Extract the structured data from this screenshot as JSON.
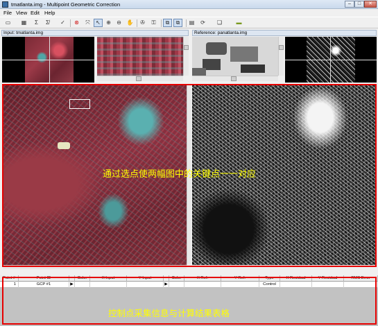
{
  "window": {
    "title": "tmatlanta.img - Multipoint Geometric Correction",
    "controls": {
      "minimize": "–",
      "maximize": "□",
      "close": "✕"
    }
  },
  "menu": [
    "File",
    "View",
    "Edit",
    "Help"
  ],
  "toolbar": {
    "icons": [
      "window-icon",
      "table-icon",
      "sigma-icon",
      "sigma-edit-icon",
      "checkmark-icon",
      "gcp-target-icon",
      "fit-icon",
      "select-arrow-icon",
      "zoom-in-icon",
      "zoom-out-icon",
      "pan-hand-icon",
      "target-icon",
      "lock-icon",
      "link-icon",
      "link-all-icon",
      "calc-icon",
      "refresh-icon",
      "stack-icon",
      "ruler-icon"
    ]
  },
  "panels": {
    "input_label": "Input: tmatlanta.img",
    "reference_label": "Reference: panatlanta.img"
  },
  "annotations": {
    "views_caption": "通过选点使两幅图中的关键点一一对应",
    "table_caption": "控制点采集信息与计算结果表格"
  },
  "gcp_table": {
    "columns": [
      "Point #",
      "Point ID",
      "",
      "Color",
      "X Input",
      "Y Input",
      "",
      "Color",
      "X Ref.",
      "Y Ref.",
      "Type",
      "X Residual",
      "Y Residual",
      "RMS Error"
    ],
    "rows": [
      [
        "1",
        "GCP #1",
        "▶",
        "",
        "",
        "",
        "▶",
        "",
        "",
        "",
        "Control",
        "",
        "",
        ""
      ]
    ]
  },
  "colors": {
    "highlight_frame": "#e60000",
    "caption_text": "#ffff00",
    "table_empty_bg": "#c2c2c2"
  }
}
